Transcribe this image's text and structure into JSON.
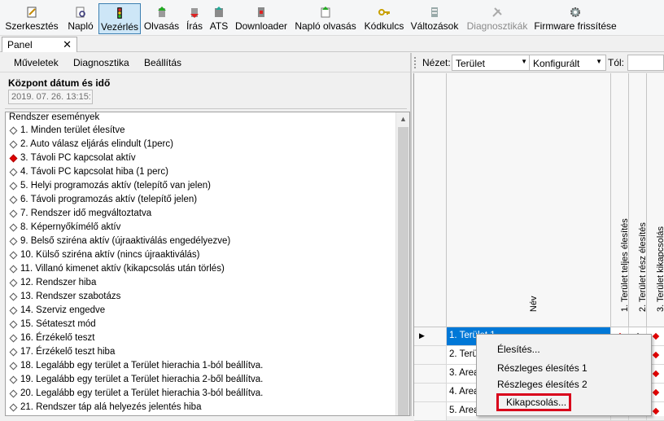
{
  "toolbar": {
    "buttons": [
      {
        "label": "Szerkesztés",
        "icon": "edit-icon"
      },
      {
        "label": "Napló",
        "icon": "log-search-icon"
      },
      {
        "label": "Vezérlés",
        "icon": "traffic-light-icon",
        "active": true
      },
      {
        "label": "Olvasás",
        "icon": "read-icon"
      },
      {
        "label": "Írás",
        "icon": "write-icon"
      },
      {
        "label": "ATS",
        "icon": "ats-icon"
      },
      {
        "label": "Downloader",
        "icon": "downloader-icon"
      },
      {
        "label": "Napló olvasás",
        "icon": "log-read-icon"
      },
      {
        "label": "Kódkulcs",
        "icon": "key-icon"
      },
      {
        "label": "Változások",
        "icon": "changes-icon"
      },
      {
        "label": "Diagnosztikák",
        "icon": "diagnostics-icon",
        "disabled": true
      },
      {
        "label": "Firmware frissítése",
        "icon": "firmware-gear-icon"
      }
    ]
  },
  "tabs": {
    "panel_label": "Panel",
    "close_glyph": "✕"
  },
  "left_menu": {
    "items": [
      "Műveletek",
      "Diagnosztika",
      "Beállítás"
    ]
  },
  "datetime": {
    "title": "Központ dátum és idő",
    "value": "2019. 07. 26. 13:15:"
  },
  "events": {
    "header": "Rendszer események",
    "items": [
      {
        "text": "1. Minden terület élesítve",
        "active": false
      },
      {
        "text": "2. Auto válasz eljárás elindult (1perc)",
        "active": false
      },
      {
        "text": "3. Távoli PC kapcsolat aktív",
        "active": true
      },
      {
        "text": "4. Távoli PC kapcsolat hiba (1 perc)",
        "active": false
      },
      {
        "text": "5. Helyi programozás aktív (telepítő van jelen)",
        "active": false
      },
      {
        "text": "6. Távoli programozás aktív (telepítő jelen)",
        "active": false
      },
      {
        "text": "7. Rendszer idő megváltoztatva",
        "active": false
      },
      {
        "text": "8. Képernyőkímélő aktív",
        "active": false
      },
      {
        "text": "9. Belső sziréna aktív (újraaktiválás engedélyezve)",
        "active": false
      },
      {
        "text": "10. Külső sziréna aktív (nincs újraaktiválás)",
        "active": false
      },
      {
        "text": "11. Villanó kimenet aktív (kikapcsolás után törlés)",
        "active": false
      },
      {
        "text": "12. Rendszer hiba",
        "active": false
      },
      {
        "text": "13. Rendszer szabotázs",
        "active": false
      },
      {
        "text": "14. Szerviz engedve",
        "active": false
      },
      {
        "text": "15. Sétateszt mód",
        "active": false
      },
      {
        "text": "16. Érzékelő teszt",
        "active": false
      },
      {
        "text": "17. Érzékelő teszt hiba",
        "active": false
      },
      {
        "text": "18. Legalább egy terület a Terület hierachia 1-ból beállítva.",
        "active": false
      },
      {
        "text": "19. Legalább egy terület a Terület hierachia 2-ből beállítva.",
        "active": false
      },
      {
        "text": "20. Legalább egy terület a Terület hierachia 3-ból beállítva.",
        "active": false
      },
      {
        "text": "21. Rendszer táp alá helyezés jelentés hiba",
        "active": false
      }
    ]
  },
  "right_bar": {
    "view_label": "Nézet:",
    "view_value": "Terület",
    "config_value": "Konfigurált",
    "from_label": "Tól:"
  },
  "grid": {
    "headers": {
      "name": "Név",
      "col1": "1. Terület teljes élesítés",
      "col2": "2. Terület rész élesítés",
      "col3": "3. Terület kikapcsolás"
    },
    "rows": [
      {
        "name": "1. Terület 1",
        "selected": true
      },
      {
        "name": "2. Terü",
        "selected": false
      },
      {
        "name": "3. Area",
        "selected": false
      },
      {
        "name": "4. Area",
        "selected": false
      },
      {
        "name": "5. Area",
        "selected": false
      }
    ]
  },
  "context_menu": {
    "items": [
      "Élesítés...",
      "Részleges élesítés 1",
      "Részleges élesítés 2",
      "Kikapcsolás..."
    ],
    "highlighted_index": 3,
    "highlight_color": "#d9001b"
  },
  "colors": {
    "selection": "#0078d7",
    "active_marker": "#e00000",
    "active_tool": "#cde6f7"
  }
}
